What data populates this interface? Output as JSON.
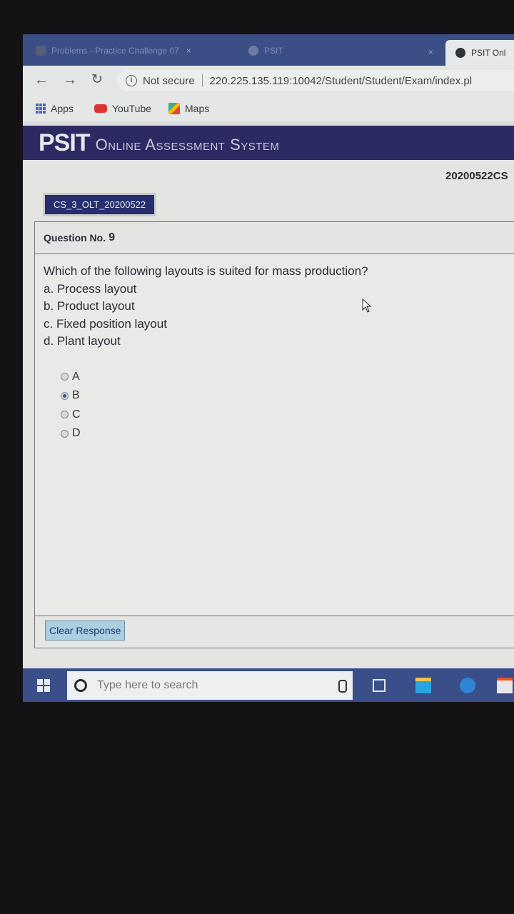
{
  "browser": {
    "tabs": [
      {
        "label": "Problems - Practice Challenge 07",
        "close": "×"
      },
      {
        "label": "PSIT",
        "close": "×"
      },
      {
        "label": "PSIT Onl"
      }
    ],
    "security_label": "Not secure",
    "url": "220.225.135.119:10042/Student/Student/Exam/index.pl",
    "bookmarks": [
      "Apps",
      "YouTube",
      "Maps"
    ]
  },
  "header": {
    "logo": "PSIT",
    "system_name": "Online Assessment System"
  },
  "exam": {
    "exam_id": "20200522CS",
    "test_code": "CS_3_OLT_20200522"
  },
  "question": {
    "label": "Question No.",
    "number": "9",
    "text": "Which of the following layouts is suited for mass production?",
    "choices": [
      "a. Process layout",
      "b. Product layout",
      "c. Fixed position layout",
      "d. Plant layout"
    ],
    "options": [
      "A",
      "B",
      "C",
      "D"
    ],
    "selected": "B"
  },
  "actions": {
    "clear_response": "Clear Response"
  },
  "taskbar": {
    "search_placeholder": "Type here to search"
  }
}
